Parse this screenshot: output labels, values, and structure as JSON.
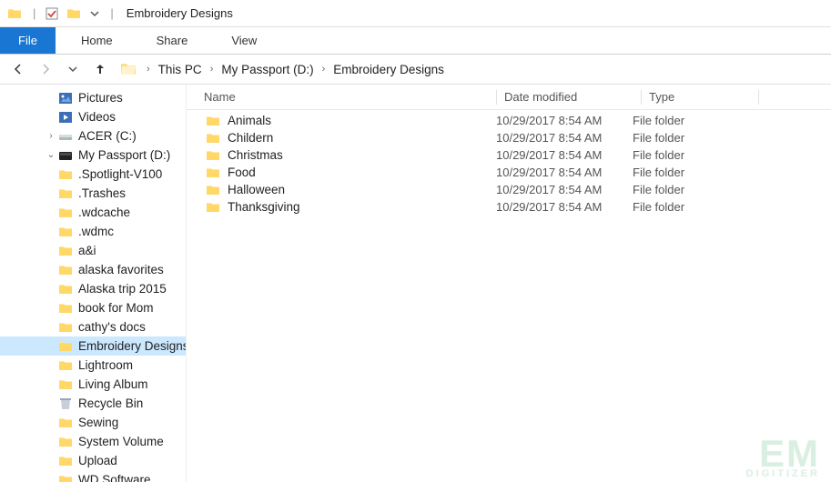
{
  "window": {
    "title": "Embroidery Designs"
  },
  "ribbon": {
    "file_label": "File",
    "tabs": [
      {
        "label": "Home"
      },
      {
        "label": "Share"
      },
      {
        "label": "View"
      }
    ]
  },
  "nav": {
    "crumbs": [
      {
        "label": "This PC"
      },
      {
        "label": "My Passport (D:)"
      },
      {
        "label": "Embroidery Designs"
      }
    ]
  },
  "tree": {
    "items": [
      {
        "label": "Pictures",
        "icon": "pictures",
        "level": 1
      },
      {
        "label": "Videos",
        "icon": "videos",
        "level": 1
      },
      {
        "label": "ACER (C:)",
        "icon": "drive-c",
        "level": 1,
        "expand": "right"
      },
      {
        "label": "My Passport (D:)",
        "icon": "drive-ext",
        "level": 1,
        "expand": "down"
      },
      {
        "label": ".Spotlight-V100",
        "icon": "folder",
        "level": 2
      },
      {
        "label": ".Trashes",
        "icon": "folder",
        "level": 2
      },
      {
        "label": ".wdcache",
        "icon": "folder",
        "level": 2
      },
      {
        "label": ".wdmc",
        "icon": "folder",
        "level": 2
      },
      {
        "label": "a&i",
        "icon": "folder",
        "level": 2
      },
      {
        "label": "alaska favorites",
        "icon": "folder",
        "level": 2
      },
      {
        "label": "Alaska trip 2015",
        "icon": "folder",
        "level": 2
      },
      {
        "label": "book for Mom",
        "icon": "folder",
        "level": 2
      },
      {
        "label": "cathy's docs",
        "icon": "folder",
        "level": 2
      },
      {
        "label": "Embroidery Designs",
        "icon": "folder",
        "level": 2,
        "selected": true
      },
      {
        "label": "Lightroom",
        "icon": "folder",
        "level": 2
      },
      {
        "label": "Living Album",
        "icon": "folder",
        "level": 2
      },
      {
        "label": "Recycle Bin",
        "icon": "recycle-bin",
        "level": 2
      },
      {
        "label": "Sewing",
        "icon": "folder",
        "level": 2
      },
      {
        "label": "System Volume",
        "icon": "folder",
        "level": 2
      },
      {
        "label": "Upload",
        "icon": "folder",
        "level": 2
      },
      {
        "label": "WD Software",
        "icon": "folder",
        "level": 2
      }
    ]
  },
  "columns": {
    "name": "Name",
    "date": "Date modified",
    "type": "Type"
  },
  "files": [
    {
      "name": "Animals",
      "date": "10/29/2017 8:54 AM",
      "type": "File folder"
    },
    {
      "name": "Childern",
      "date": "10/29/2017 8:54 AM",
      "type": "File folder"
    },
    {
      "name": "Christmas",
      "date": "10/29/2017 8:54 AM",
      "type": "File folder"
    },
    {
      "name": "Food",
      "date": "10/29/2017 8:54 AM",
      "type": "File folder"
    },
    {
      "name": "Halloween",
      "date": "10/29/2017 8:54 AM",
      "type": "File folder"
    },
    {
      "name": "Thanksgiving",
      "date": "10/29/2017 8:54 AM",
      "type": "File folder"
    }
  ],
  "watermark": {
    "main": "EM",
    "sub": "DIGITIZER"
  }
}
